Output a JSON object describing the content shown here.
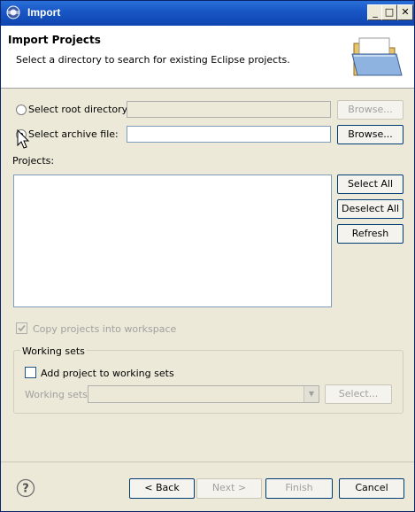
{
  "window": {
    "title": "Import",
    "controls": {
      "minimize": "_",
      "maximize": "□",
      "close": "✕"
    }
  },
  "header": {
    "title": "Import Projects",
    "description": "Select a directory to search for existing Eclipse projects.",
    "icon": "folder-icon"
  },
  "source": {
    "root_label": "Select root directory:",
    "root_value": "",
    "root_browse": "Browse...",
    "archive_label": "Select archive file:",
    "archive_value": "",
    "archive_browse": "Browse...",
    "selected": "archive"
  },
  "projects": {
    "label": "Projects:",
    "items": [],
    "select_all": "Select All",
    "deselect_all": "Deselect All",
    "refresh": "Refresh"
  },
  "copy_projects": {
    "label": "Copy projects into workspace",
    "checked": true,
    "enabled": false
  },
  "working_sets": {
    "legend": "Working sets",
    "add_label": "Add project to working sets",
    "add_checked": false,
    "sets_label": "Working sets:",
    "sets_value": "",
    "select_button": "Select..."
  },
  "footer": {
    "back": "< Back",
    "next": "Next >",
    "finish": "Finish",
    "cancel": "Cancel",
    "help_icon": "help-icon"
  }
}
